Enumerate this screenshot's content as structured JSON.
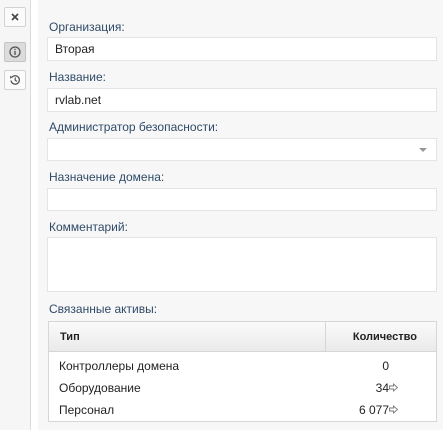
{
  "toolbar": {
    "close_icon": "close-icon",
    "info_icon": "info-icon",
    "history_icon": "history-icon"
  },
  "form": {
    "organization_label": "Организация:",
    "organization_value": "Вторая",
    "name_label": "Название:",
    "name_value": "rvlab.net",
    "security_admin_label": "Администратор безопасности:",
    "security_admin_value": "",
    "domain_purpose_label": "Назначение домена:",
    "domain_purpose_value": "",
    "comment_label": "Комментарий:",
    "comment_value": ""
  },
  "assets": {
    "label": "Связанные активы:",
    "columns": [
      "Тип",
      "Количество"
    ],
    "rows": [
      {
        "type": "Контроллеры домена",
        "count": "0",
        "link": false
      },
      {
        "type": "Оборудование",
        "count": "34",
        "link": true
      },
      {
        "type": "Персонал",
        "count": "6 077",
        "link": true
      }
    ]
  }
}
